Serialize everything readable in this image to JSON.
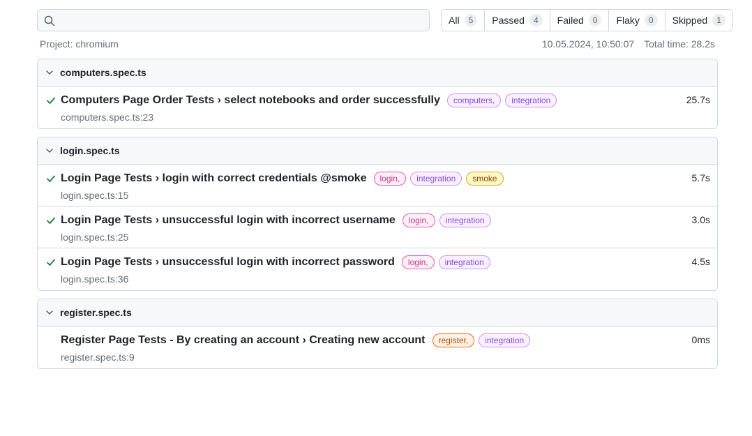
{
  "search": {
    "value": "",
    "placeholder": ""
  },
  "filters": [
    {
      "label": "All",
      "count": "5"
    },
    {
      "label": "Passed",
      "count": "4"
    },
    {
      "label": "Failed",
      "count": "0"
    },
    {
      "label": "Flaky",
      "count": "0"
    },
    {
      "label": "Skipped",
      "count": "1"
    }
  ],
  "meta": {
    "project": "Project: chromium",
    "timestamp": "10.05.2024, 10:50:07",
    "total_time": "Total time: 28.2s"
  },
  "groups": [
    {
      "file": "computers.spec.ts",
      "tests": [
        {
          "status": "passed",
          "name": "Computers Page Order Tests › select notebooks and order successfully",
          "tags": [
            {
              "text": "computers,",
              "kind": "computers"
            },
            {
              "text": "integration",
              "kind": "integration"
            }
          ],
          "location": "computers.spec.ts:23",
          "duration": "25.7s"
        }
      ]
    },
    {
      "file": "login.spec.ts",
      "tests": [
        {
          "status": "passed",
          "name": "Login Page Tests › login with correct credentials @smoke",
          "tags": [
            {
              "text": "login,",
              "kind": "login"
            },
            {
              "text": "integration",
              "kind": "integration"
            },
            {
              "text": "smoke",
              "kind": "smoke"
            }
          ],
          "location": "login.spec.ts:15",
          "duration": "5.7s"
        },
        {
          "status": "passed",
          "name": "Login Page Tests › unsuccessful login with incorrect username",
          "tags": [
            {
              "text": "login,",
              "kind": "login"
            },
            {
              "text": "integration",
              "kind": "integration"
            }
          ],
          "location": "login.spec.ts:25",
          "duration": "3.0s"
        },
        {
          "status": "passed",
          "name": "Login Page Tests › unsuccessful login with incorrect password",
          "tags": [
            {
              "text": "login,",
              "kind": "login"
            },
            {
              "text": "integration",
              "kind": "integration"
            }
          ],
          "location": "login.spec.ts:36",
          "duration": "4.5s"
        }
      ]
    },
    {
      "file": "register.spec.ts",
      "tests": [
        {
          "status": "skipped",
          "name": "Register Page Tests - By creating an account › Creating new account",
          "tags": [
            {
              "text": "register,",
              "kind": "register"
            },
            {
              "text": "integration",
              "kind": "integration"
            }
          ],
          "location": "register.spec.ts:9",
          "duration": "0ms"
        }
      ]
    }
  ],
  "colors": {
    "passed": "#1a7f37",
    "border": "#d0d7de",
    "header_bg": "#f6f8fa"
  },
  "icons": {
    "search": "search-icon",
    "chevron": "chevron-down-icon",
    "passed": "check-icon"
  }
}
